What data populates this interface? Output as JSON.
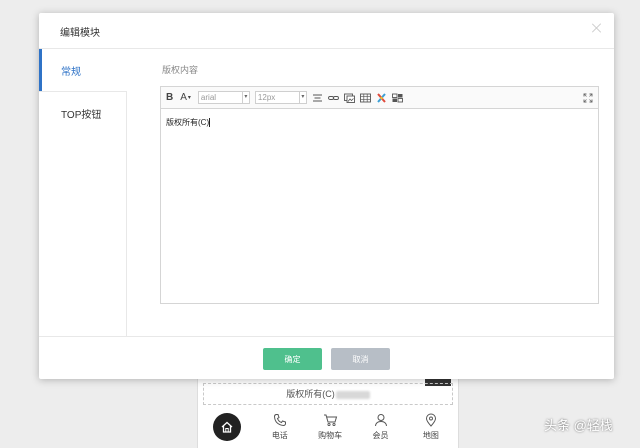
{
  "modal": {
    "title": "编辑模块",
    "tabs": [
      {
        "label": "常规",
        "active": true
      },
      {
        "label": "TOP按钮",
        "active": false
      }
    ],
    "field_label": "版权内容",
    "toolbar": {
      "bold": "B",
      "font_color": "A",
      "font_family": "arial",
      "font_size": "12px"
    },
    "editor_content": "版权所有(C)",
    "ok_label": "确定",
    "cancel_label": "取消"
  },
  "background": {
    "copyright_text": "版权所有(C)",
    "nav": [
      {
        "label": "电话",
        "icon": "phone-icon"
      },
      {
        "label": "购物车",
        "icon": "cart-icon"
      },
      {
        "label": "会员",
        "icon": "user-icon"
      },
      {
        "label": "地图",
        "icon": "map-pin-icon"
      }
    ]
  },
  "watermark": "头条 @轻栈",
  "colors": {
    "accent": "#2f73c7",
    "ok_button": "#4fc08d",
    "cancel_button": "#b7bec6"
  }
}
